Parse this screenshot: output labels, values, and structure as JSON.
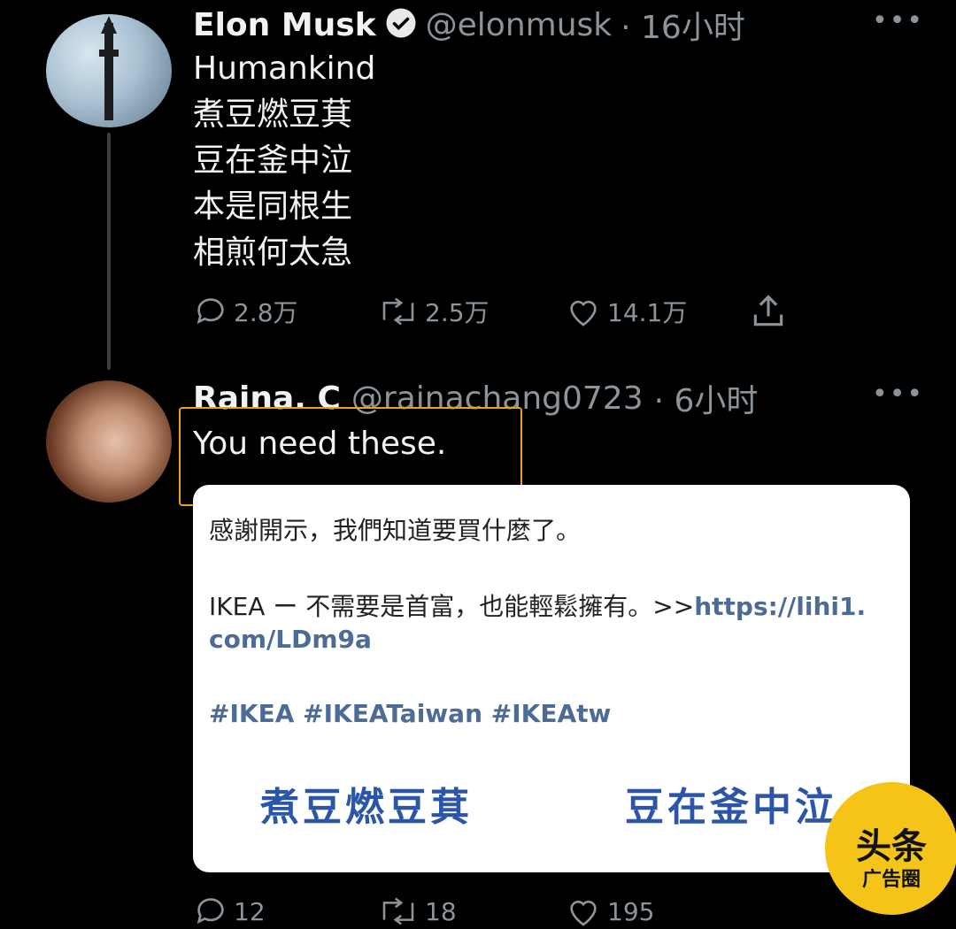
{
  "tweet1": {
    "author_name": "Elon Musk",
    "verified_icon": "verified-badge-icon",
    "handle": "@elonmusk",
    "time": "· 16小时",
    "lines": [
      "Humankind",
      "煮豆燃豆萁",
      "豆在釜中泣",
      "本是同根生",
      "相煎何太急"
    ],
    "replies": "2.8万",
    "retweets": "2.5万",
    "likes": "14.1万"
  },
  "tweet2": {
    "author_name": "Raina. C",
    "handle": "@rainachang0723",
    "time": "· 6小时",
    "text": "You need these.",
    "highlight_color": "#e8a316",
    "card": {
      "line1": "感謝開示，我們知道要買什麼了。",
      "line2_text": "IKEA ー 不需要是首富，也能輕鬆擁有。>>",
      "line2_link": "https://lihi1.",
      "line3_link": "com/LDm9a",
      "hashtags": "#IKEA #IKEATaiwan #IKEAtw",
      "big_left": "煮豆燃豆萁",
      "big_right": "豆在釜中泣"
    },
    "replies": "12",
    "retweets": "18",
    "likes": "195"
  },
  "watermark": {
    "line1": "头条",
    "line2": "广告圈",
    "color": "#f4c419"
  }
}
